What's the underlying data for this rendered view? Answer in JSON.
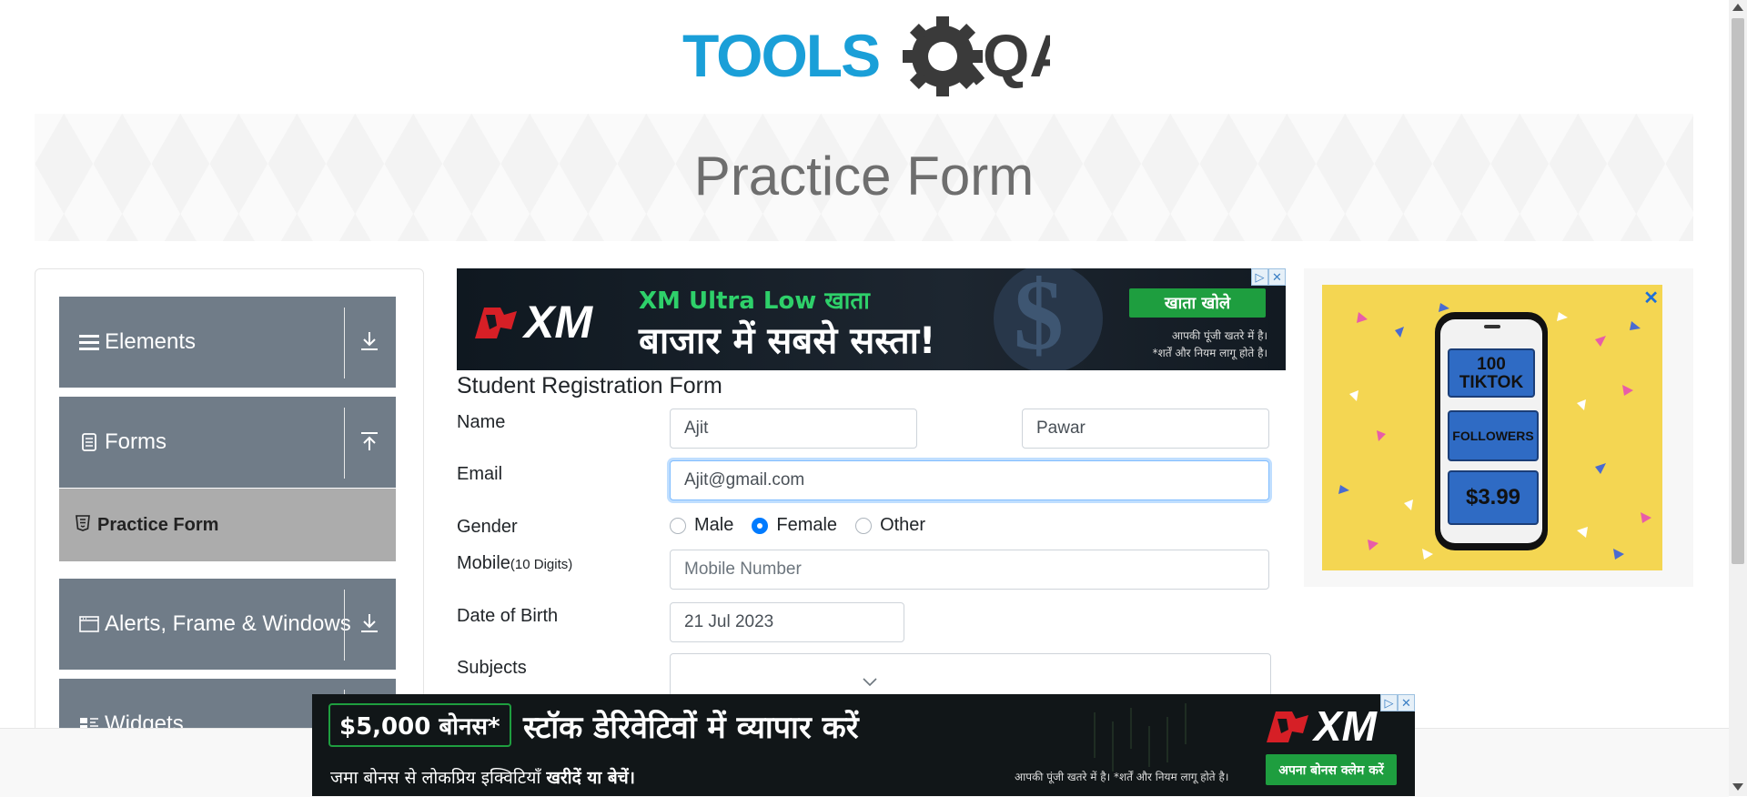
{
  "logo": {
    "text_tools": "TOOLS",
    "text_qa": "QA"
  },
  "banner": {
    "title": "Practice Form"
  },
  "sidebar": {
    "groups": [
      {
        "label": "Elements",
        "icon": "hamburger-icon",
        "arrow": "download-arrow-icon"
      },
      {
        "label": "Forms",
        "icon": "document-icon",
        "arrow": "upload-arrow-icon"
      },
      {
        "label": "Alerts, Frame & Windows",
        "icon": "window-icon",
        "arrow": "download-arrow-icon"
      },
      {
        "label": "Widgets",
        "icon": "widgets-icon"
      }
    ],
    "active_item": {
      "label": "Practice Form",
      "icon": "html5-icon"
    }
  },
  "ads": {
    "top": {
      "brand": "XM",
      "headline1": "XM Ultra Low खाता",
      "headline2": "बाजार में सबसे सस्ता!",
      "cta": "खाता खोले",
      "disclaimer1": "आपकी पूंजी खतरे में है।",
      "disclaimer2": "*शर्तें और नियम लागू होते है।"
    },
    "right": {
      "line1": "100",
      "line2": "TIKTOK",
      "line3": "FOLLOWERS",
      "price": "$3.99"
    },
    "bottom": {
      "bonus": "$5,000 बोनस*",
      "headline": "स्टॉक डेरिवेटिवों में व्यापार करें",
      "sub_prefix": "जमा बोनस से लोकप्रिय इक्विटियाँ ",
      "sub_bold": "खरीदें या बेचें।",
      "brand": "XM",
      "disclaimer": "आपकी पूंजी खतरे में है। *शर्तें और नियम लागू होते है।",
      "cta": "अपना बोनस क्लेम करें"
    }
  },
  "form": {
    "title": "Student Registration Form",
    "name_label": "Name",
    "first_name": "Ajit",
    "last_name": "Pawar",
    "email_label": "Email",
    "email_value": "Ajit@gmail.com",
    "gender_label": "Gender",
    "gender_options": [
      "Male",
      "Female",
      "Other"
    ],
    "gender_selected": "Female",
    "mobile_label": "Mobile",
    "mobile_hint": "(10 Digits)",
    "mobile_placeholder": "Mobile Number",
    "dob_label": "Date of Birth",
    "dob_value": "21 Jul 2023",
    "subjects_label": "Subjects"
  },
  "colors": {
    "brand_blue": "#1a9fd8",
    "brand_dark": "#3a3a3a",
    "sidebar_group": "#707c88",
    "active_item": "#acacac",
    "radio_checked": "#007bff",
    "xm_red": "#d61f26",
    "cta_green": "#1e9e3f"
  }
}
